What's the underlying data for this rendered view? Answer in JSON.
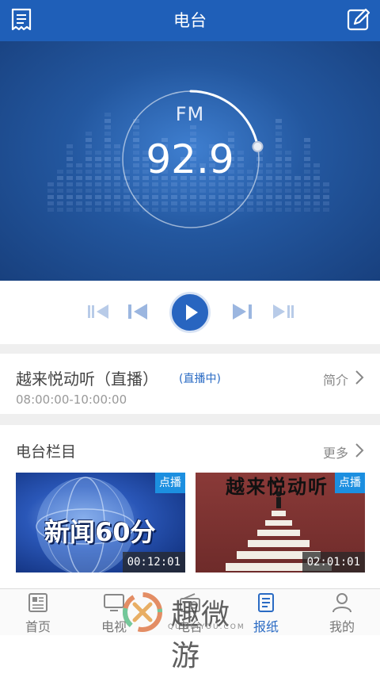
{
  "header": {
    "title": "电台",
    "left_icon": "receipt-list-icon",
    "right_icon": "edit-pen-icon",
    "color": "#1f5fb8"
  },
  "player": {
    "band": "FM",
    "frequency": "92.9",
    "dial_progress": 0.22,
    "controls": [
      "skip-back-icon",
      "previous-icon",
      "play-icon",
      "next-icon",
      "skip-forward-icon"
    ]
  },
  "program": {
    "name": "越来悦动听（直播）",
    "live_label": "(直播中)",
    "time": "08:00:00-10:00:00",
    "intro_label": "简介"
  },
  "columns": {
    "title": "电台栏目",
    "more_label": "更多",
    "items": [
      {
        "title": "新闻60分",
        "badge": "点播",
        "duration": "00:12:01"
      },
      {
        "title": "越来悦动听",
        "badge": "点播",
        "duration": "02:01:01"
      }
    ]
  },
  "tabbar": {
    "tabs": [
      {
        "label": "首页",
        "icon": "newspaper-home-icon",
        "active": false
      },
      {
        "label": "电视",
        "icon": "tv-icon",
        "active": false
      },
      {
        "label": "电台",
        "icon": "radio-icon",
        "active": false
      },
      {
        "label": "报纸",
        "icon": "newspaper-icon",
        "active": true
      },
      {
        "label": "我的",
        "icon": "user-icon",
        "active": false
      }
    ],
    "active_color": "#2a6bc4"
  },
  "watermark": {
    "text": "趣微游",
    "sub": "QUWEIYOU.COM"
  }
}
